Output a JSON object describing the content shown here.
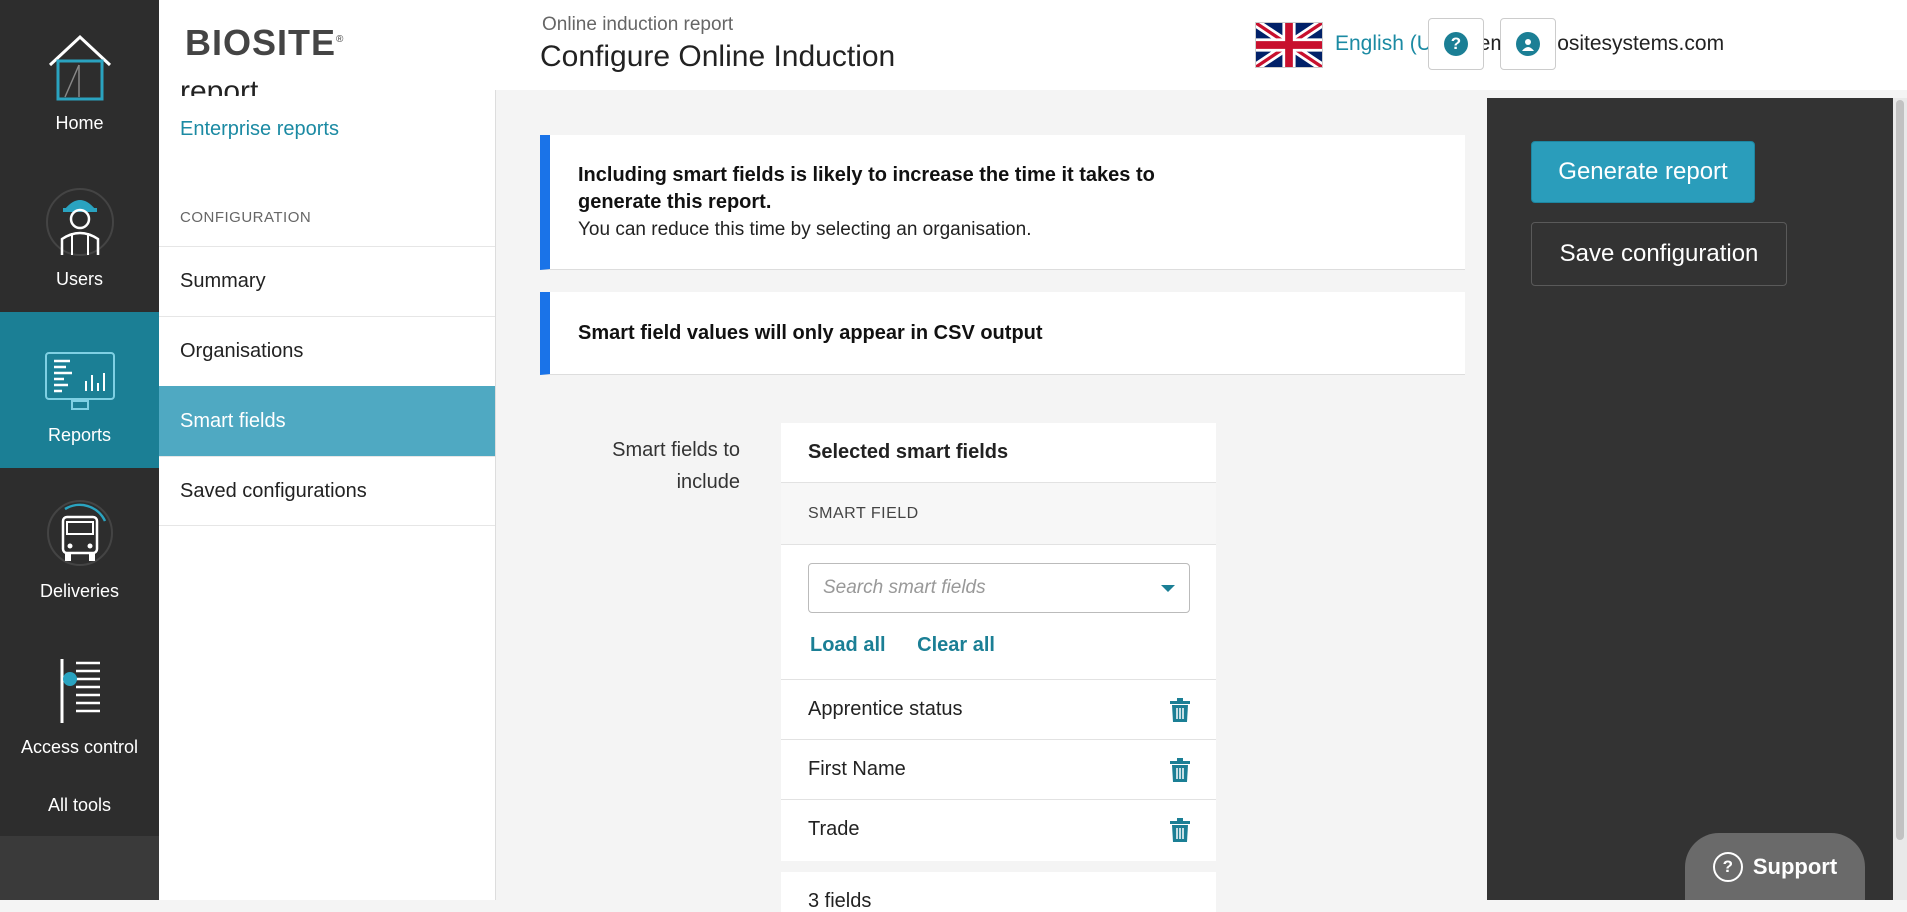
{
  "nav": {
    "items": [
      {
        "label": "Home",
        "icon": "home-icon",
        "active": false
      },
      {
        "label": "Users",
        "icon": "worker-icon",
        "active": false
      },
      {
        "label": "Reports",
        "icon": "reports-icon",
        "active": true
      },
      {
        "label": "Deliveries",
        "icon": "truck-icon",
        "active": false
      },
      {
        "label": "Access control",
        "icon": "access-control-icon",
        "active": false
      }
    ],
    "all_tools": "All tools"
  },
  "subpanel": {
    "logo": "BIOSITE",
    "logo_mark": "®",
    "title_fragment": "report",
    "enterprise_link": "Enterprise reports",
    "section_label": "CONFIGURATION",
    "menu": [
      {
        "label": "Summary",
        "active": false
      },
      {
        "label": "Organisations",
        "active": false
      },
      {
        "label": "Smart fields",
        "active": true
      },
      {
        "label": "Saved configurations",
        "active": false
      }
    ]
  },
  "header": {
    "breadcrumb": "Online induction report",
    "title": "Configure Online Induction",
    "language": "English (UK)",
    "user_email": "demo@biositesystems.com",
    "help_icon": "help-icon",
    "account_icon": "user-icon"
  },
  "notices": {
    "smart_fields_time_title": "Including smart fields is likely to increase the time it takes to generate this report.",
    "smart_fields_time_body": "You can reduce this time by selecting an organisation.",
    "csv_only": "Smart field values will only appear in CSV output"
  },
  "smart_fields": {
    "label": "Smart fields to include",
    "card_title": "Selected smart fields",
    "column_header": "SMART FIELD",
    "search_placeholder": "Search smart fields",
    "load_all": "Load all",
    "clear_all": "Clear all",
    "rows": [
      "Apprentice status",
      "First Name",
      "Trade"
    ],
    "footer": "3 fields"
  },
  "actions": {
    "generate": "Generate report",
    "save": "Save configuration"
  },
  "support": {
    "label": "Support"
  },
  "colors": {
    "accent": "#1b7f95",
    "active_menu": "#4fa9c2",
    "notice_border": "#1a73e8",
    "generate_button": "#2a9dbb",
    "dark_panel": "#333333"
  }
}
